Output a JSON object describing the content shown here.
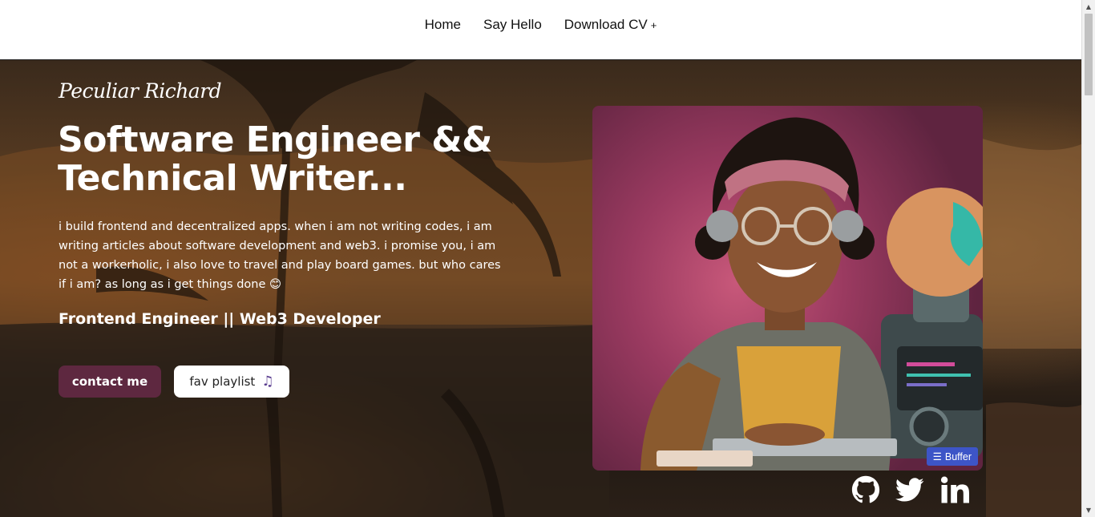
{
  "nav": {
    "items": [
      {
        "label": "Home"
      },
      {
        "label": "Say Hello"
      },
      {
        "label": "Download CV",
        "suffix": "+"
      }
    ]
  },
  "hero": {
    "logo": "Peculiar Richard",
    "headline_line1": "Software Engineer &&",
    "headline_line2": "Technical Writer...",
    "bio": "i build frontend and decentralized apps. when i am not writing codes, i am writing articles about software development and web3. i promise you, i am not a workerholic, i also love to travel and play board games. but who cares if i am? as long as i get things done 😊",
    "roles": "Frontend Engineer || Web3 Developer",
    "contact_label": "contact me",
    "playlist_label": "fav playlist",
    "playlist_icon": "♫",
    "buffer_label": "Buffer"
  },
  "social": [
    {
      "name": "github-icon"
    },
    {
      "name": "twitter-icon"
    },
    {
      "name": "linkedin-icon"
    }
  ],
  "colors": {
    "contact_button": "#5e2840",
    "playlist_icon": "#5a3d8f",
    "buffer_badge": "#3d55c7"
  }
}
